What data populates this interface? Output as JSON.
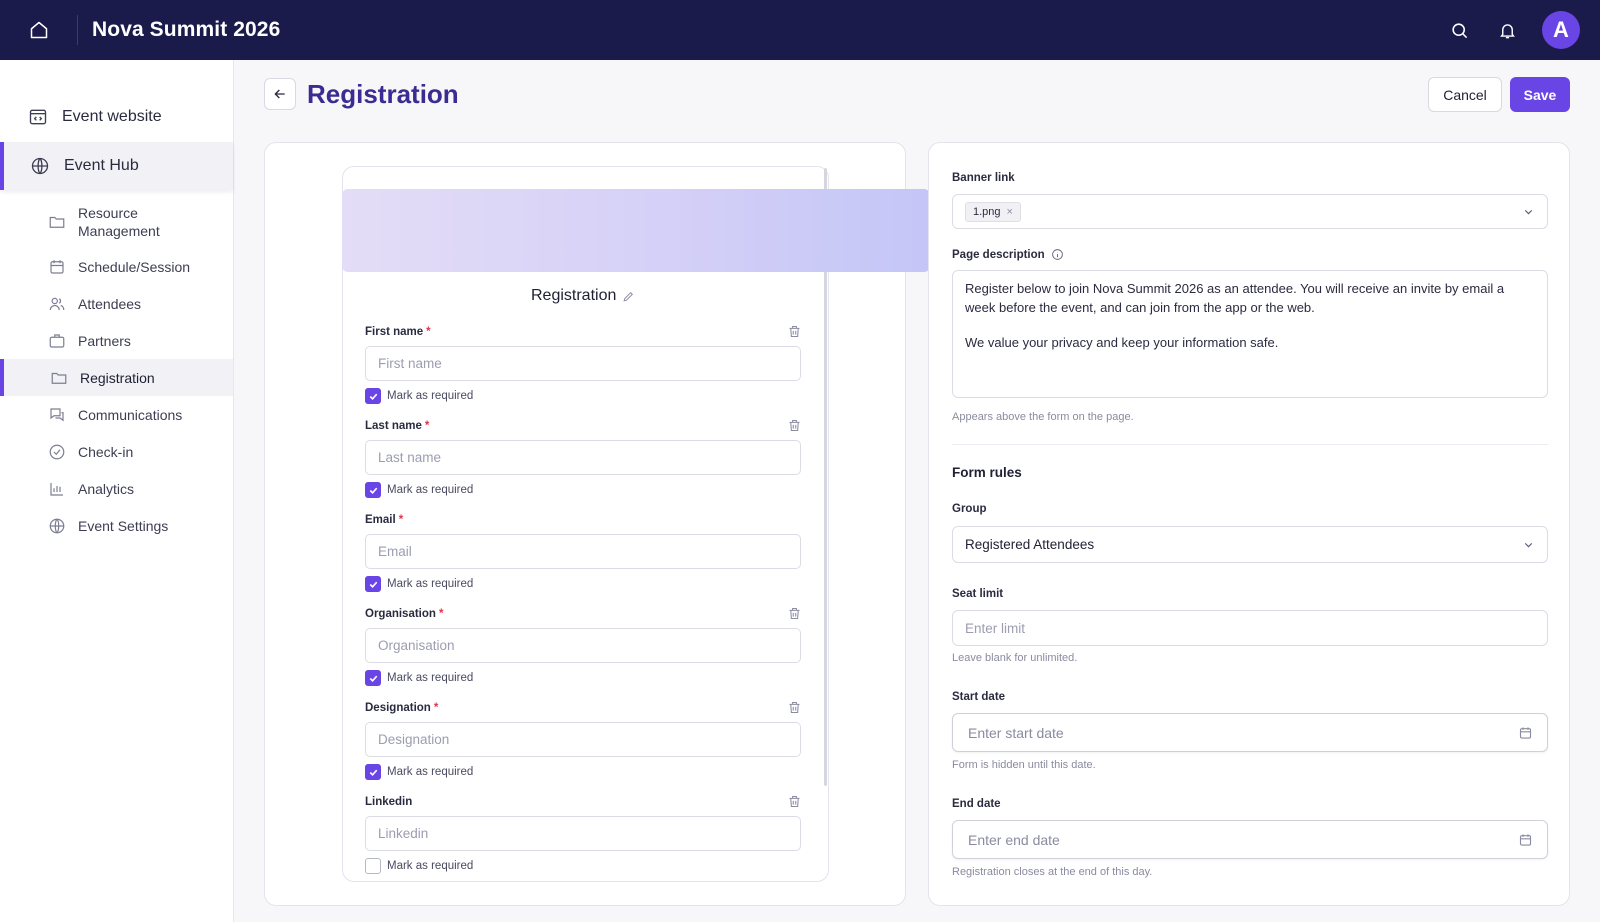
{
  "app": {
    "title": "Nova Summit 2026",
    "avatar_letter": "A",
    "accent": "#6a45e6",
    "topbar_bg": "#1b1b4b"
  },
  "icons": {
    "home": "home-icon",
    "search": "search-icon",
    "bell": "bell-icon"
  },
  "sidebar": {
    "top_items": [
      {
        "label": "Event website",
        "icon": "website-icon"
      },
      {
        "label": "Event Hub",
        "icon": "globe-icon",
        "active": true
      }
    ],
    "items": [
      {
        "label": "Resource Management",
        "icon": "folder-icon"
      },
      {
        "label": "Schedule/Session",
        "icon": "calendar-icon"
      },
      {
        "label": "Attendees",
        "icon": "users-icon"
      },
      {
        "label": "Partners",
        "icon": "briefcase-icon"
      },
      {
        "label": "Registration",
        "icon": "folder-icon",
        "active": true
      },
      {
        "label": "Communications",
        "icon": "chat-icon"
      },
      {
        "label": "Check-in",
        "icon": "check-circle-icon"
      },
      {
        "label": "Analytics",
        "icon": "bar-chart-icon"
      },
      {
        "label": "Event Settings",
        "icon": "globe-icon"
      }
    ]
  },
  "header": {
    "title": "Registration",
    "cancel": "Cancel",
    "save": "Save"
  },
  "form_preview": {
    "title": "Registration",
    "mark_required_label": "Mark as required",
    "fields": [
      {
        "label": "First name",
        "placeholder": "First name",
        "required": true,
        "checked": true,
        "deletable": true
      },
      {
        "label": "Last name",
        "placeholder": "Last name",
        "required": true,
        "checked": true,
        "deletable": true
      },
      {
        "label": "Email",
        "placeholder": "Email",
        "required": true,
        "checked": true,
        "deletable": false
      },
      {
        "label": "Organisation",
        "placeholder": "Organisation",
        "required": true,
        "checked": true,
        "deletable": true
      },
      {
        "label": "Designation",
        "placeholder": "Designation",
        "required": true,
        "checked": true,
        "deletable": true
      },
      {
        "label": "Linkedin",
        "placeholder": "Linkedin",
        "required": false,
        "checked": false,
        "deletable": true
      }
    ]
  },
  "settings": {
    "banner_label": "Banner link",
    "banner_file": "1.png",
    "page_desc_label": "Page description",
    "page_desc_p1": "Register below to join Nova Summit 2026 as an attendee. You will receive an invite by email a week before the event, and can join from the app or the web.",
    "page_desc_p2": "We value your privacy and keep your information safe.",
    "page_desc_help": "Appears above the form on the page.",
    "form_rules_title": "Form rules",
    "group_label": "Group",
    "group_value": "Registered Attendees",
    "seat_label": "Seat limit",
    "seat_placeholder": "Enter limit",
    "seat_help": "Leave blank for unlimited.",
    "start_label": "Start date",
    "start_placeholder": "Enter start date",
    "start_help": "Form is hidden until this date.",
    "end_label": "End date",
    "end_placeholder": "Enter end date",
    "end_help": "Registration closes at the end of this day."
  }
}
